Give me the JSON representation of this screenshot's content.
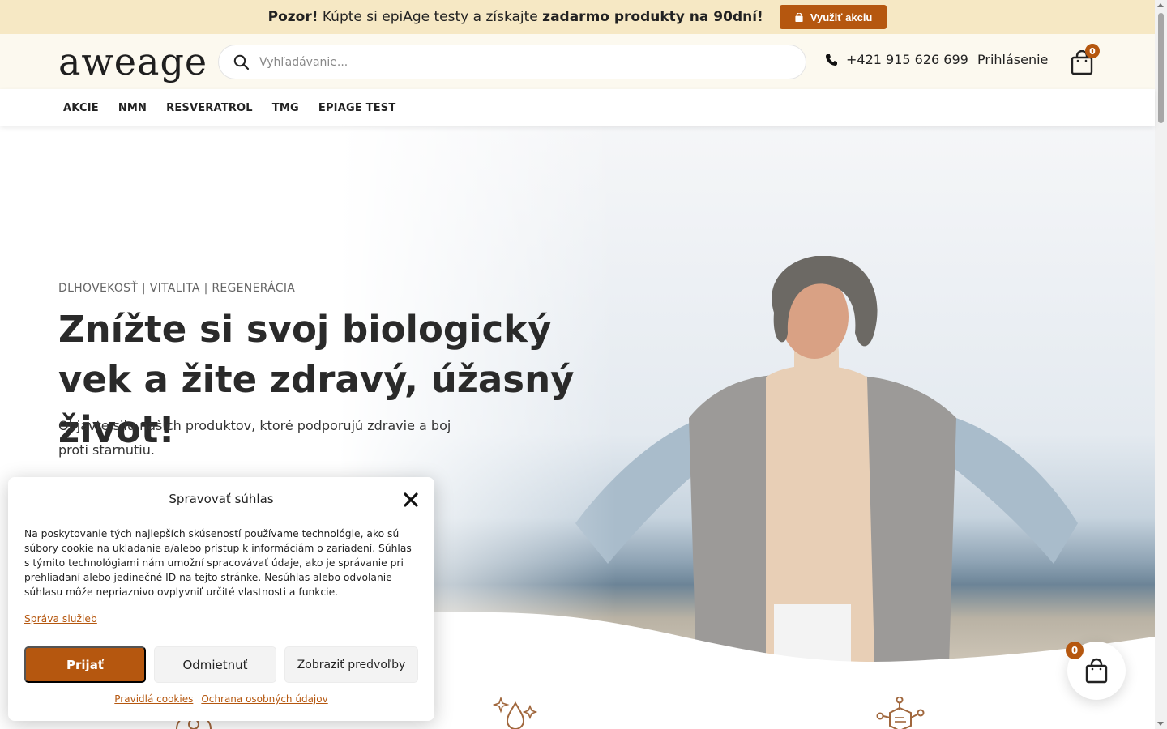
{
  "announcement": {
    "lead": "Pozor!",
    "text": " Kúpte si epiAge testy a získajte ",
    "highlight": "zadarmo produkty na 90dní!",
    "button_label": "Využiť akciu"
  },
  "header": {
    "logo": "aweage",
    "search_placeholder": "Vyhľadávanie...",
    "phone": "+421 915 626 699",
    "login": "Prihlásenie",
    "cart_count": "0"
  },
  "nav": [
    "AKCIE",
    "NMN",
    "RESVERATROL",
    "TMG",
    "EPIAGE TEST"
  ],
  "hero": {
    "eyebrow": "DLHOVEKOSŤ | VITALITA | REGENERÁCIA",
    "headline": "Znížte si svoj biologický vek a žite zdravý, úžasný život!",
    "subtext": "Objavte silu našich produktov, ktoré podporujú zdravie a boj proti starnutiu."
  },
  "cookie": {
    "title": "Spravovať súhlas",
    "body": "Na poskytovanie tých najlepších skúseností používame technológie, ako sú súbory cookie na ukladanie a/alebo prístup k informáciám o zariadení. Súhlas s týmito technológiami nám umožní spracovávať údaje, ako je správanie pri prehliadaní alebo jedinečné ID na tejto stránke. Nesúhlas alebo odvolanie súhlasu môže nepriaznivo ovplyvniť určité vlastnosti a funkcie.",
    "manage_link": "Správa služieb",
    "accept": "Prijať",
    "deny": "Odmietnuť",
    "preferences": "Zobraziť predvoľby",
    "cookie_policy": "Pravidlá cookies",
    "privacy": "Ochrana osobných údajov"
  },
  "floating_cart_count": "0",
  "colors": {
    "accent": "#b5570f",
    "topbar_bg": "#f6e8c4",
    "header_bg": "#fcf9ef"
  }
}
